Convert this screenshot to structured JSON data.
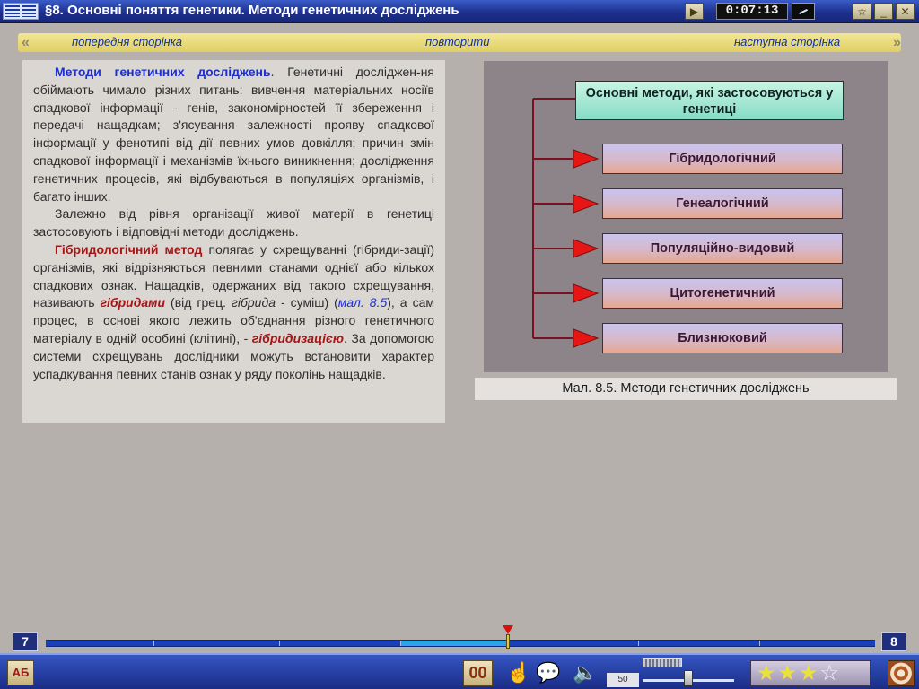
{
  "window": {
    "title": "§8. Основні поняття генетики. Методи генетичних досліджень",
    "timer": "0:07:13"
  },
  "nav": {
    "prev": "попередня сторінка",
    "repeat": "повторити",
    "next": "наступна сторінка"
  },
  "text": {
    "p1_term": "Методи генетичних досліджень",
    "p1_body": ". Генетичні досліджен-ня обіймають чимало різних питань: вивчення матеріальних носіїв спадкової інформації - генів, закономірностей її збереження і передачі нащадкам; з'ясування залежності прояву спадкової інформації у фенотипі від дії певних умов довкілля; причин змін спадкової інформації і механізмів їхнього виникнення; дослідження генетичних процесів, які відбуваються в популяціях організмів, і багато інших.",
    "p2": "Залежно від рівня організації живої матерії в генетиці застосовують і відповідні методи досліджень.",
    "p3_term": "Гібридологічний метод",
    "p3_a": " полягає у схрещуванні (гібриди-зації) організмів, які відрізняються певними станами однієї або кількох спадкових ознак. Нащадків, одержаних від такого схрещування, називають ",
    "p3_hybrids": "гібридами",
    "p3_b": " (від грец. ",
    "p3_greek": "гібрида",
    "p3_c": " - суміш) (",
    "p3_ref": "мал. 8.5",
    "p3_d": "), а сам процес, в основі якого лежить об'єднання різного генетичного матеріалу в одній особині (клітині), - ",
    "p3_hybridization": "гібридизацією",
    "p3_e": ". За допомогою системи схрещувань дослідники можуть встановити характер успадкування певних станів ознак у ряду поколінь нащадків."
  },
  "diagram": {
    "root": "Основні методи, які застосовуються у генетиці",
    "methods": [
      "Гібридологічний",
      "Генеалогічний",
      "Популяційно-видовий",
      "Цитогенетичний",
      "Близнюковий"
    ],
    "caption": "Мал. 8.5. Методи генетичних досліджень",
    "line_color": "#7a1020",
    "arrow_color": "#e81515"
  },
  "footer": {
    "prev_page": "7",
    "next_page": "8",
    "abc_label": "АБ",
    "oo_label": "00",
    "volume": "50",
    "rating_filled": 3,
    "rating_total": 4
  }
}
